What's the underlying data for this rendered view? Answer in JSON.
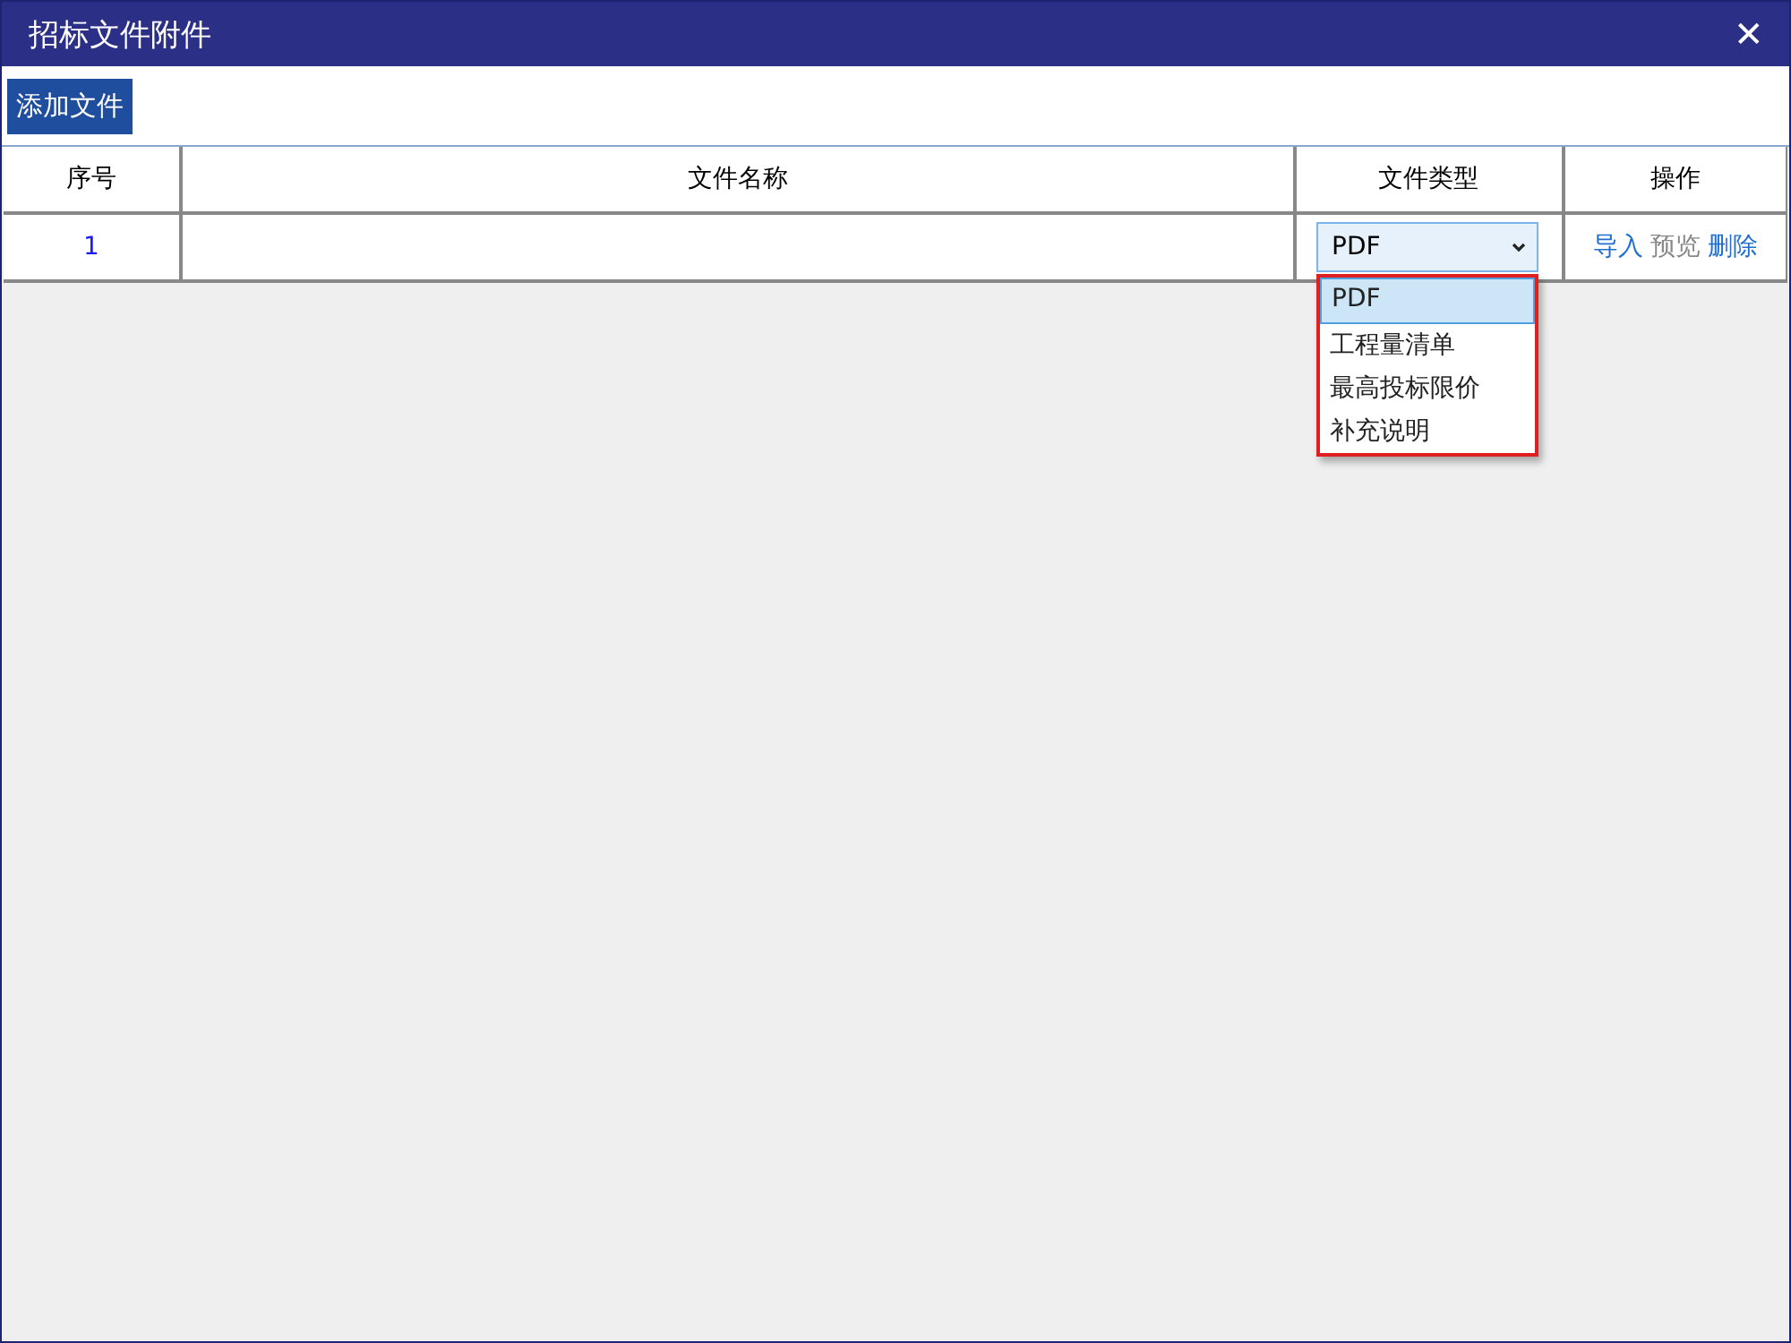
{
  "window": {
    "title": "招标文件附件",
    "close_icon": "✕"
  },
  "toolbar": {
    "add_button": "添加文件"
  },
  "table": {
    "columns": [
      "序号",
      "文件名称",
      "文件类型",
      "操作"
    ],
    "rows": [
      {
        "index": "1",
        "file_name": "",
        "file_type": {
          "value": "PDF",
          "expanded": true,
          "options": [
            {
              "label": "PDF",
              "selected": true
            },
            {
              "label": "工程量清单",
              "selected": false
            },
            {
              "label": "最高投标限价",
              "selected": false
            },
            {
              "label": "补充说明",
              "selected": false
            }
          ]
        },
        "actions": [
          {
            "label": "导入",
            "disabled": false
          },
          {
            "label": "预览",
            "disabled": true
          },
          {
            "label": "删除",
            "disabled": false
          }
        ]
      }
    ]
  }
}
